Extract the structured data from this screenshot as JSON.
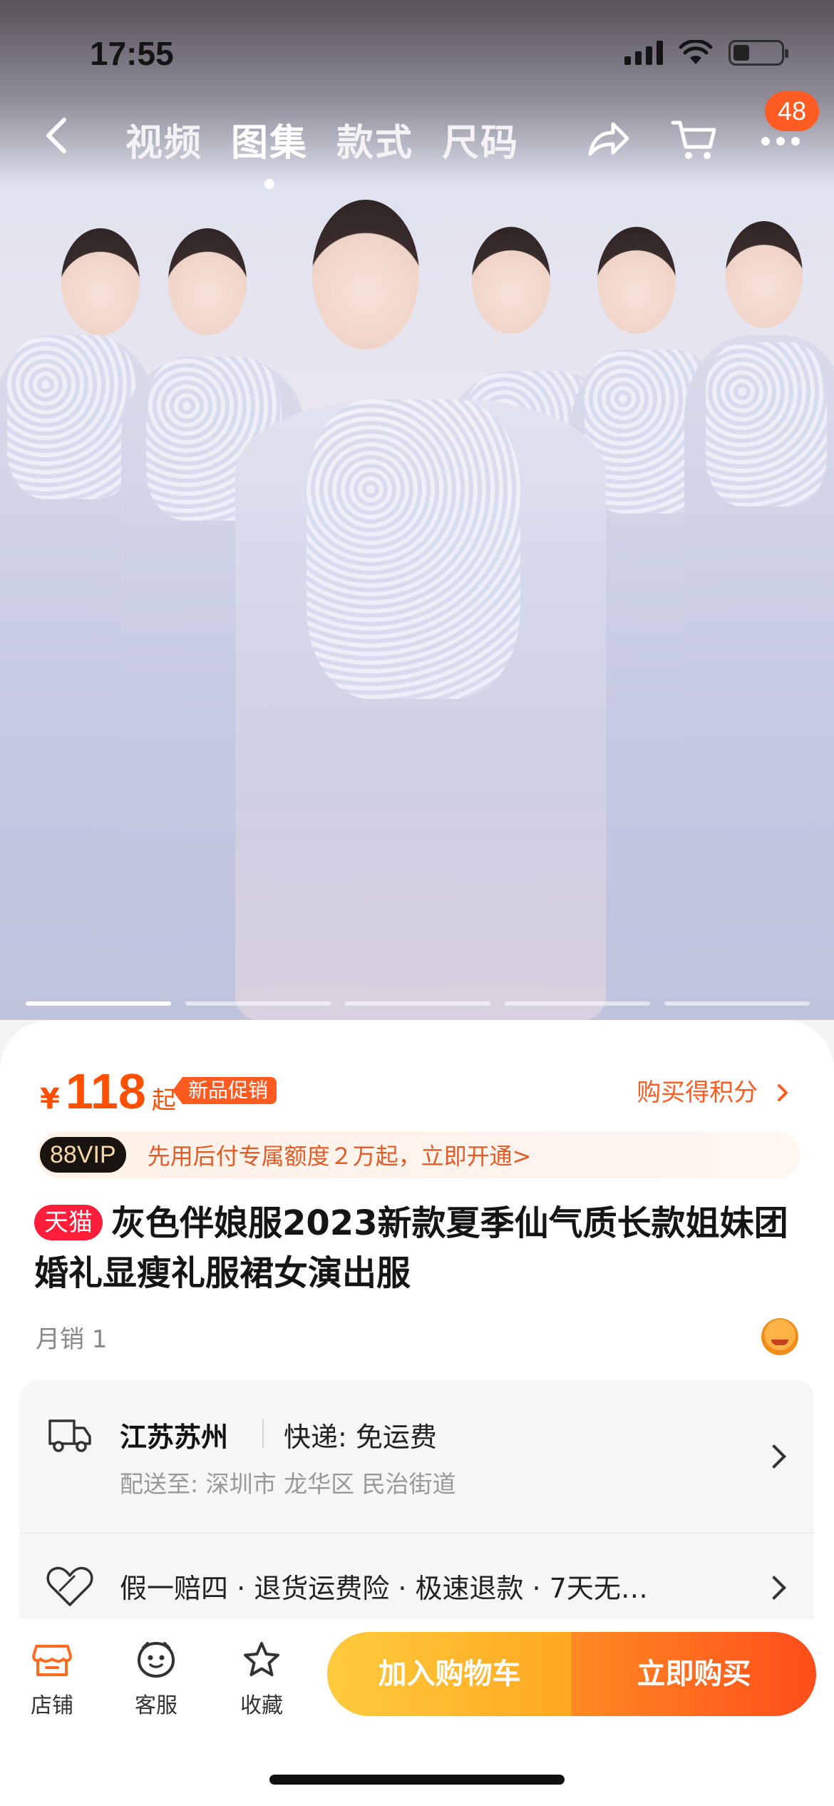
{
  "status_bar": {
    "time": "17:55"
  },
  "nav": {
    "tabs": [
      {
        "label": "视频",
        "active": false
      },
      {
        "label": "图集",
        "active": true
      },
      {
        "label": "款式",
        "active": false
      },
      {
        "label": "尺码",
        "active": false
      }
    ],
    "icons": [
      "back-icon",
      "share-icon",
      "cart-icon",
      "more-icon"
    ],
    "more_badge": "48"
  },
  "gallery": {
    "page_count": 5,
    "current_page": 1
  },
  "price": {
    "currency": "¥",
    "amount": "118",
    "suffix": "起",
    "promo_tag": "新品促销",
    "points_link": "购买得积分"
  },
  "vip": {
    "badge": "88VIP",
    "text": "先用后付专属额度２万起，立即开通>"
  },
  "product": {
    "store_tag": "天猫",
    "title": "灰色伴娘服2023新款夏季仙气质长款姐妹团婚礼显瘦礼服裙女演出服",
    "monthly_sales": "月销 1"
  },
  "shipping": {
    "origin": "江苏苏州",
    "method": "快递: 免运费",
    "destination": "配送至: 深圳市 龙华区 民治街道"
  },
  "guarantee": {
    "text": "假一赔四 · 退货运费险 · 极速退款 · 7天无…"
  },
  "bottom_bar": {
    "store": "店铺",
    "service": "客服",
    "favorite": "收藏",
    "add_to_cart": "加入购物车",
    "buy_now": "立即购买"
  },
  "colors": {
    "accent": "#ff4f00",
    "tmall_red": "#ff1d3a",
    "cart_button": "#ffb52a",
    "buy_button": "#ff6a1f"
  }
}
